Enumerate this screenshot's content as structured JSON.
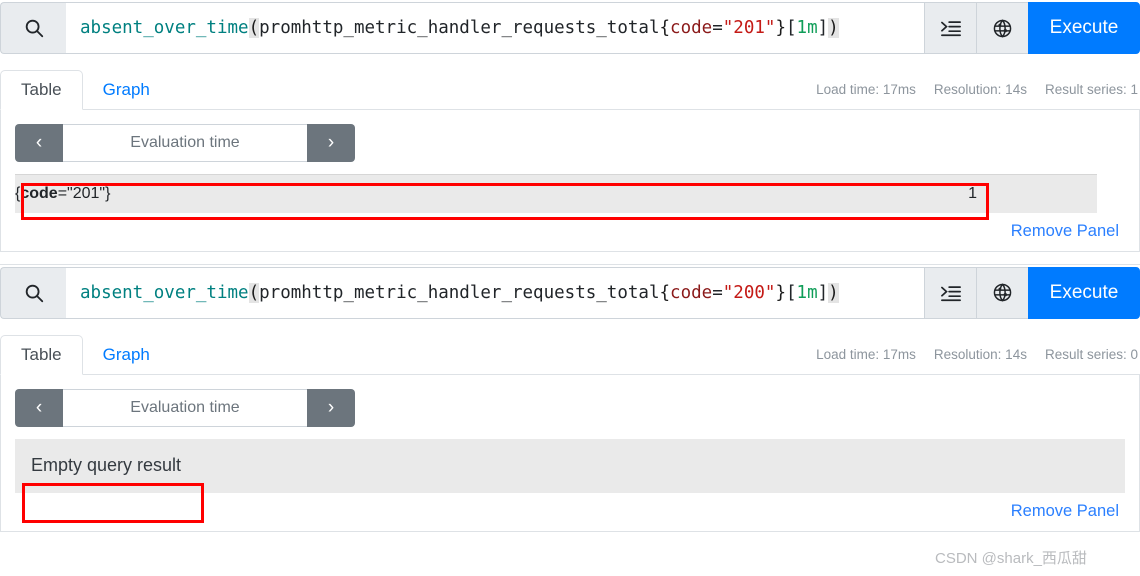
{
  "panels": [
    {
      "search_icon": "search-icon",
      "expression": {
        "full_text": "absent_over_time(promhttp_metric_handler_requests_total{code=\"201\"}[1m])",
        "tokens": [
          {
            "text": "absent_over_time",
            "kind": "fn"
          },
          {
            "text": "(",
            "kind": "paren"
          },
          {
            "text": "promhttp_metric_handler_requests_total",
            "kind": "metric"
          },
          {
            "text": "{",
            "kind": "brace"
          },
          {
            "text": "code",
            "kind": "label"
          },
          {
            "text": "=",
            "kind": "op"
          },
          {
            "text": "\"201\"",
            "kind": "str"
          },
          {
            "text": "}",
            "kind": "brace"
          },
          {
            "text": "[",
            "kind": "bracket"
          },
          {
            "text": "1m",
            "kind": "dur"
          },
          {
            "text": "]",
            "kind": "bracket"
          },
          {
            "text": ")",
            "kind": "paren"
          }
        ]
      },
      "format_icon": "format-expression-icon",
      "metrics_explorer_icon": "metrics-explorer-globe-icon",
      "execute_label": "Execute",
      "tabs": [
        {
          "label": "Table",
          "active": true
        },
        {
          "label": "Graph",
          "active": false
        }
      ],
      "meta": {
        "load_time": "Load time: 17ms",
        "resolution": "Resolution: 14s",
        "result_series": "Result series: 1"
      },
      "eval_time": {
        "prev_label": "‹",
        "placeholder": "Evaluation time",
        "next_label": "›"
      },
      "result": {
        "type": "table",
        "rows": [
          {
            "label_open": "{",
            "label_key": "code",
            "label_eq": "=",
            "label_val": "\"201\"",
            "label_close": "}",
            "value": "1"
          }
        ]
      },
      "remove_label": "Remove Panel"
    },
    {
      "search_icon": "search-icon",
      "expression": {
        "full_text": "absent_over_time(promhttp_metric_handler_requests_total{code=\"200\"}[1m])",
        "tokens": [
          {
            "text": "absent_over_time",
            "kind": "fn"
          },
          {
            "text": "(",
            "kind": "paren"
          },
          {
            "text": "promhttp_metric_handler_requests_total",
            "kind": "metric"
          },
          {
            "text": "{",
            "kind": "brace"
          },
          {
            "text": "code",
            "kind": "label"
          },
          {
            "text": "=",
            "kind": "op"
          },
          {
            "text": "\"200\"",
            "kind": "str"
          },
          {
            "text": "}",
            "kind": "brace"
          },
          {
            "text": "[",
            "kind": "bracket"
          },
          {
            "text": "1m",
            "kind": "dur"
          },
          {
            "text": "]",
            "kind": "bracket"
          },
          {
            "text": ")",
            "kind": "paren"
          }
        ]
      },
      "format_icon": "format-expression-icon",
      "metrics_explorer_icon": "metrics-explorer-globe-icon",
      "execute_label": "Execute",
      "tabs": [
        {
          "label": "Table",
          "active": true
        },
        {
          "label": "Graph",
          "active": false
        }
      ],
      "meta": {
        "load_time": "Load time: 17ms",
        "resolution": "Resolution: 14s",
        "result_series": "Result series: 0"
      },
      "eval_time": {
        "prev_label": "‹",
        "placeholder": "Evaluation time",
        "next_label": "›"
      },
      "result": {
        "type": "empty",
        "empty_text": "Empty query result"
      },
      "remove_label": "Remove Panel"
    }
  ],
  "watermark": "CSDN @shark_西瓜甜",
  "colors": {
    "accent": "#007bff",
    "link": "#2a7fff",
    "annotation": "#ff0000",
    "result_row_bg": "#eaeaea",
    "muted": "#8d959d",
    "token_fn": "#008080",
    "token_string": "#c41a16",
    "token_label": "#8b1a1a",
    "token_duration": "#0f9d58"
  }
}
